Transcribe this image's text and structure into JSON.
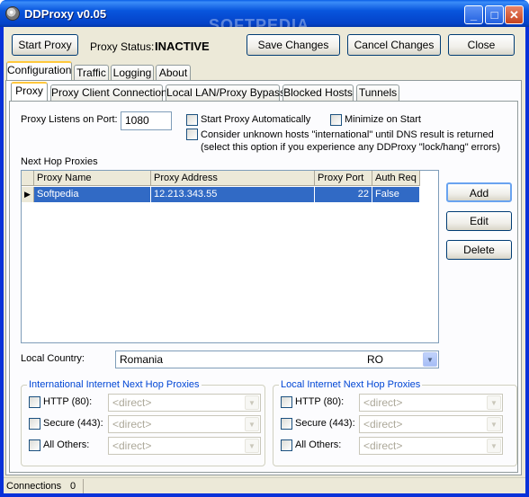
{
  "window": {
    "title": "DDProxy v0.05",
    "watermark": "SOFTPEDIA",
    "controls": {
      "minimize": "_",
      "maximize": "□",
      "close": "✕"
    }
  },
  "toolbar": {
    "start_proxy": "Start Proxy",
    "status_label": "Proxy Status:",
    "status_value": "INACTIVE",
    "save_changes": "Save Changes",
    "cancel_changes": "Cancel Changes",
    "close": "Close"
  },
  "main_tabs": [
    "Configuration",
    "Traffic",
    "Logging",
    "About"
  ],
  "sub_tabs": [
    "Proxy",
    "Proxy Client Connections",
    "Local LAN/Proxy Bypass",
    "Blocked Hosts",
    "Tunnels"
  ],
  "proxy": {
    "port_label": "Proxy Listens on Port:",
    "port_value": "1080",
    "start_auto": "Start Proxy Automatically",
    "minimize_start": "Minimize on Start",
    "consider_unknown": "Consider unknown hosts \"international\" until DNS result is returned",
    "consider_note": "(select this option if you experience any DDProxy \"lock/hang\" errors)",
    "next_hop_label": "Next Hop Proxies",
    "grid_headers": [
      "Proxy Name",
      "Proxy Address",
      "Proxy Port",
      "Auth Req"
    ],
    "grid_rows": [
      {
        "name": "Softpedia",
        "address": "12.213.343.55",
        "port": "22",
        "auth": "False"
      }
    ],
    "add": "Add",
    "edit": "Edit",
    "delete": "Delete",
    "country_label": "Local Country:",
    "country_value": "Romania",
    "country_code": "RO"
  },
  "intl_group": {
    "title": "International Internet Next Hop Proxies",
    "rows": [
      {
        "label": "HTTP (80):",
        "value": "<direct>"
      },
      {
        "label": "Secure (443):",
        "value": "<direct>"
      },
      {
        "label": "All Others:",
        "value": "<direct>"
      }
    ]
  },
  "local_group": {
    "title": "Local Internet Next Hop Proxies",
    "rows": [
      {
        "label": "HTTP (80):",
        "value": "<direct>"
      },
      {
        "label": "Secure (443):",
        "value": "<direct>"
      },
      {
        "label": "All Others:",
        "value": "<direct>"
      }
    ]
  },
  "statusbar": {
    "label": "Connections",
    "value": "0"
  }
}
